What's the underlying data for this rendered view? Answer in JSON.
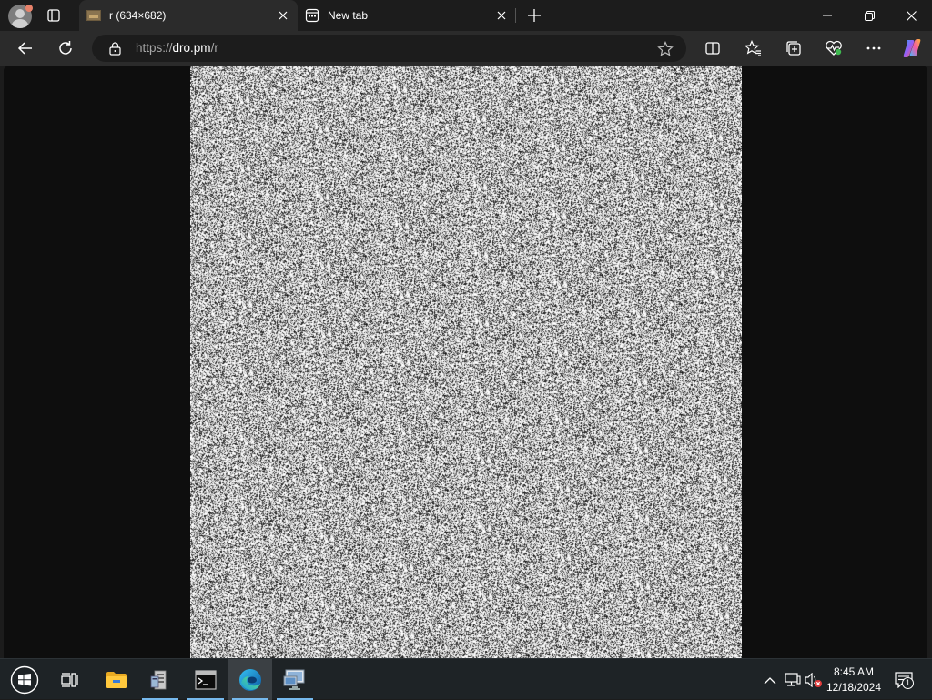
{
  "browser": {
    "tabs": [
      {
        "title": "r (634×682)",
        "active": true,
        "icon": "image-thumbnail-icon"
      },
      {
        "title": "New tab",
        "active": false,
        "icon": "new-tab-page-icon"
      }
    ],
    "address": {
      "scheme": "https://",
      "host": "dro.pm",
      "path": "/r"
    },
    "toolbar_icons": [
      "back-icon",
      "refresh-icon",
      "split-screen-icon",
      "favorites-icon",
      "collections-icon",
      "browser-essentials-icon",
      "more-icon",
      "copilot-icon"
    ],
    "window_controls": [
      "minimize-icon",
      "restore-icon",
      "close-icon"
    ]
  },
  "page": {
    "description": "image viewer showing a grayscale random-noise image",
    "image": {
      "source_width": 634,
      "source_height": 682,
      "pattern": "random grayscale noise",
      "background": "#0e0e0e"
    }
  },
  "taskbar": {
    "items": [
      {
        "name": "start",
        "icon": "windows-logo-icon"
      },
      {
        "name": "task-view",
        "icon": "task-view-icon"
      },
      {
        "name": "file-explorer",
        "icon": "folder-icon"
      },
      {
        "name": "file-server",
        "icon": "server-manager-icon"
      },
      {
        "name": "command-prompt",
        "icon": "terminal-icon"
      },
      {
        "name": "microsoft-edge",
        "icon": "edge-icon",
        "active": true
      },
      {
        "name": "remote-desktop",
        "icon": "remote-desktop-icon"
      }
    ],
    "tray": {
      "icons": [
        "show-hidden-icons-chevron",
        "network-icon",
        "volume-muted-icon"
      ],
      "time": "8:45 AM",
      "date": "12/18/2024",
      "notifications_count": "1"
    }
  },
  "colors": {
    "titlebar": "#1c1c1c",
    "toolbar": "#2b2b2b",
    "taskbar": "#1e2326",
    "accent": "#76b9ed"
  }
}
